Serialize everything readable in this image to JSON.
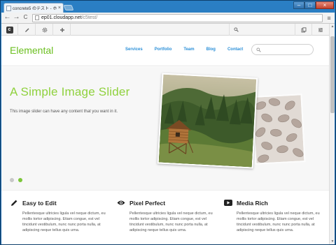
{
  "browser": {
    "tab_title": "concrete5 のテスト - ホ",
    "tab_close": "×",
    "url_host": "ep01.cloudapp.net",
    "url_path": "/c5test/",
    "back": "←",
    "forward": "→",
    "reload": "C",
    "menu": "≡",
    "minimize": "–",
    "maximize": "□",
    "close": "×"
  },
  "c5toolbar": {
    "logo": "c"
  },
  "site": {
    "brand": "Elemental",
    "nav": [
      "Services",
      "Portfolio",
      "Team",
      "Blog",
      "Contact"
    ]
  },
  "hero": {
    "title": "A Simple Image Slider",
    "text": "This image slider can have any content that you want in it.",
    "slides_total": 2,
    "active_slide": 2
  },
  "features": [
    {
      "icon": "pencil-icon",
      "title": "Easy to Edit",
      "text": "Pellentesque ultricies ligula vel neque dictum, eu mollis tortor adipiscing. Etiam congue, est vel tincidunt vestibulum, nunc nunc porta nulla, at adipiscing neque tellus quis urna."
    },
    {
      "icon": "eye-icon",
      "title": "Pixel Perfect",
      "text": "Pellentesque ultricies ligula vel neque dictum, eu mollis tortor adipiscing. Etiam congue, est vel tincidunt vestibulum, nunc nunc porta nulla, at adipiscing neque tellus quis urna."
    },
    {
      "icon": "play-icon",
      "title": "Media Rich",
      "text": "Pellentesque ultricies ligula vel neque dictum, eu mollis tortor adipiscing. Etiam congue, est vel tincidunt vestibulum, nunc nunc porta nulla, at adipiscing neque tellus quis urna."
    }
  ],
  "colors": {
    "brand": "#6bbf1f",
    "accent_title": "#8fd13d",
    "nav_link": "#2a8fd8",
    "active_dot": "#7cc63a"
  }
}
